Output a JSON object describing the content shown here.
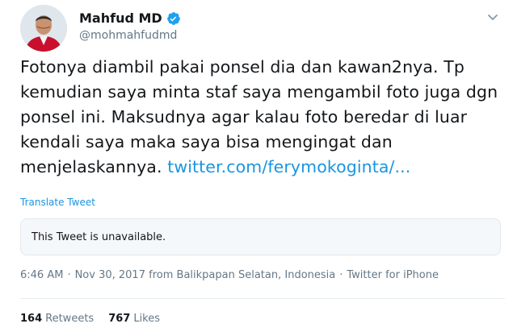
{
  "user": {
    "display_name": "Mahfud MD",
    "handle": "@mohmahfudmd",
    "verified": true
  },
  "icons": {
    "verified": "verified-badge-icon",
    "caret": "chevron-down-icon"
  },
  "tweet": {
    "text": "Fotonya diambil pakai ponsel dia dan kawan2nya. Tp kemudian saya minta staf saya mengambil foto juga dgn ponsel ini. Maksudnya agar kalau foto beredar di luar kendali saya maka saya bisa mengingat dan menjelaskannya. ",
    "link_text": "twitter.com/ferymokoginta/...",
    "translate_label": "Translate Tweet",
    "quoted_unavailable": "This Tweet is unavailable."
  },
  "meta": {
    "time": "6:46 AM",
    "separator": "·",
    "date": "Nov 30, 2017",
    "from_label": "from",
    "location": "Balikpapan Selatan, Indonesia",
    "source": "Twitter for iPhone"
  },
  "stats": {
    "retweets_count": "164",
    "retweets_label": "Retweets",
    "likes_count": "767",
    "likes_label": "Likes"
  },
  "colors": {
    "link": "#1b95e0",
    "secondary_text": "#657786",
    "primary_text": "#14171a",
    "verified_badge": "#1da1f2"
  }
}
